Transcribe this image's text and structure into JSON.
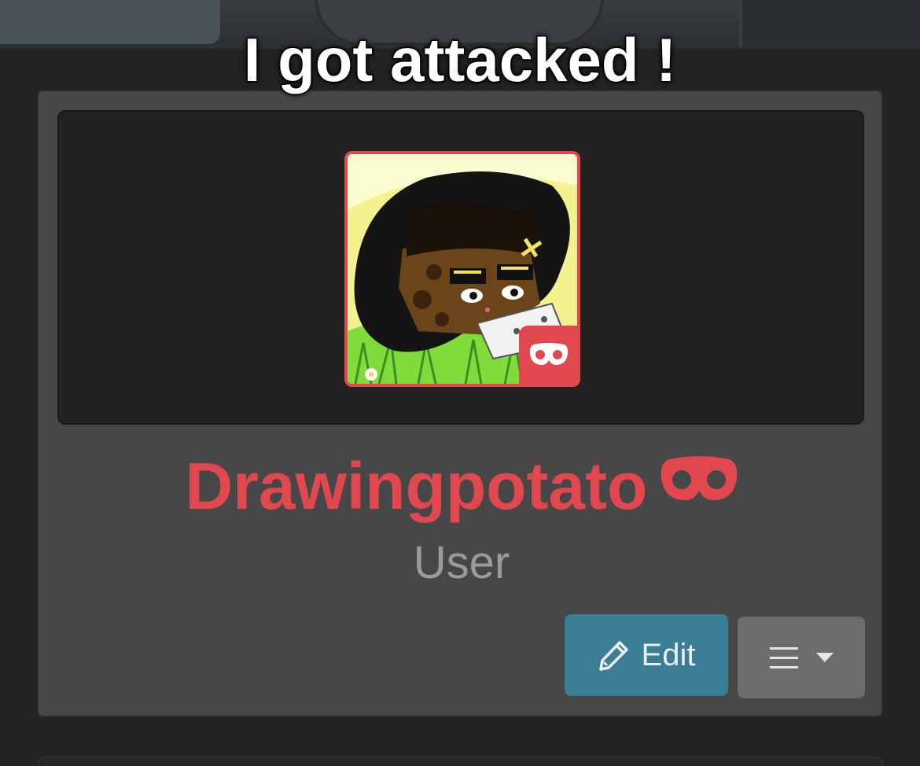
{
  "overlay": {
    "caption": "I got attacked !"
  },
  "profile": {
    "username": "Drawingpotato",
    "role": "User",
    "username_color": "#e0474f",
    "avatar_border_color": "#e0474f",
    "badge_icon": "mask-icon",
    "avatar_icon": "profile-avatar-image"
  },
  "actions": {
    "edit_label": "Edit",
    "edit_icon": "pencil-icon",
    "menu_icon": "hamburger-icon",
    "menu_dropdown_icon": "caret-down-icon",
    "edit_color": "#3a7d94",
    "menu_color": "#6d6d6d"
  }
}
